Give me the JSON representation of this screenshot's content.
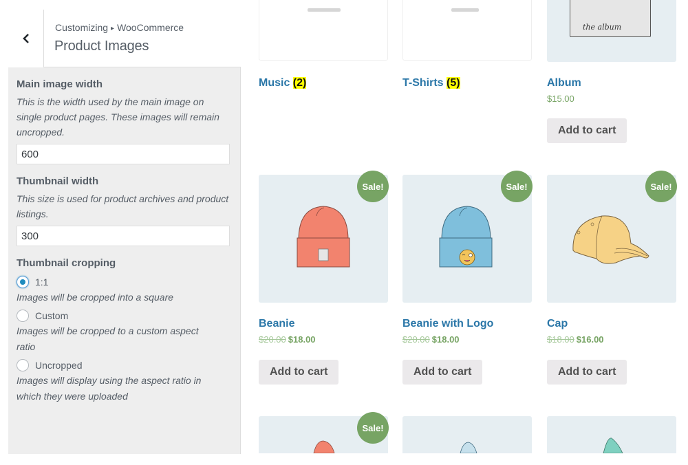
{
  "sidebar": {
    "back_label": "Back",
    "breadcrumb": {
      "root": "Customizing",
      "separator": "▸",
      "section": "WooCommerce"
    },
    "title": "Product Images",
    "main_image": {
      "title": "Main image width",
      "description": "This is the width used by the main image on single product pages. These images will remain uncropped.",
      "value": "600"
    },
    "thumbnail_width": {
      "title": "Thumbnail width",
      "description": "This size is used for product archives and product listings.",
      "value": "300"
    },
    "thumbnail_cropping": {
      "title": "Thumbnail cropping",
      "selected": "1:1",
      "options": [
        {
          "label": "1:1",
          "description": "Images will be cropped into a square",
          "checked": true
        },
        {
          "label": "Custom",
          "description": "Images will be cropped to a custom aspect ratio",
          "checked": false
        },
        {
          "label": "Uncropped",
          "description": "Images will display using the aspect ratio in which they were uploaded",
          "checked": false
        }
      ]
    }
  },
  "shop": {
    "colors": {
      "link": "#2b77a8",
      "price": "#77a464",
      "sale_badge": "#77a464",
      "thumb_bg": "#e6eef2",
      "count_highlight": "#ffff00"
    },
    "categories": [
      {
        "name": "Music",
        "count": "(2)"
      },
      {
        "name": "T-Shirts",
        "count": "(5)"
      }
    ],
    "products": [
      {
        "name": "Album",
        "price": "$15.00",
        "button": "Add to cart",
        "image_caption": "the album"
      },
      {
        "name": "Beanie",
        "regular_price": "$20.00",
        "sale_price": "$18.00",
        "sale_badge": "Sale!",
        "button": "Add to cart"
      },
      {
        "name": "Beanie with Logo",
        "regular_price": "$20.00",
        "sale_price": "$18.00",
        "sale_badge": "Sale!",
        "button": "Add to cart"
      },
      {
        "name": "Cap",
        "regular_price": "$18.00",
        "sale_price": "$16.00",
        "sale_badge": "Sale!",
        "button": "Add to cart"
      },
      {
        "sale_badge": "Sale!"
      }
    ]
  }
}
